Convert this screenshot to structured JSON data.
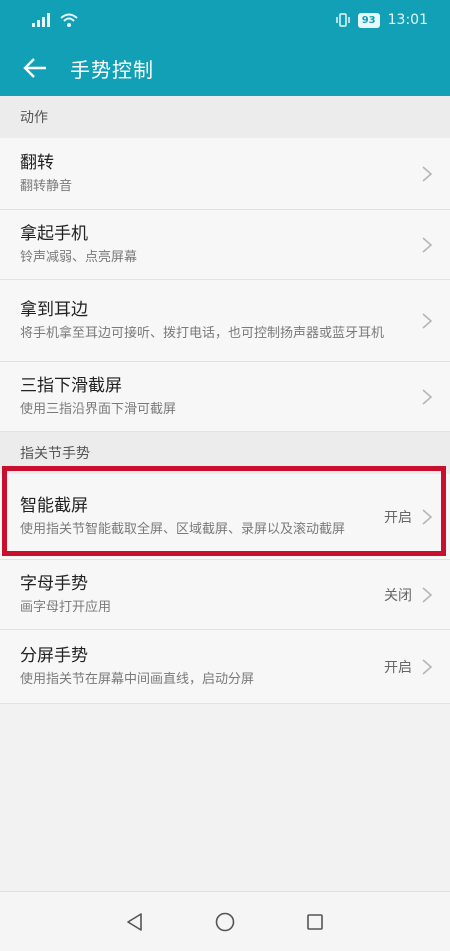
{
  "status_bar": {
    "battery": "93",
    "time": "13:01"
  },
  "header": {
    "title": "手势控制"
  },
  "sections": [
    {
      "title": "动作",
      "items": [
        {
          "title": "翻转",
          "subtitle": "翻转静音",
          "value": ""
        },
        {
          "title": "拿起手机",
          "subtitle": "铃声减弱、点亮屏幕",
          "value": ""
        },
        {
          "title": "拿到耳边",
          "subtitle": "将手机拿至耳边可接听、拨打电话，也可控制扬声器或蓝牙耳机",
          "value": ""
        },
        {
          "title": "三指下滑截屏",
          "subtitle": "使用三指沿界面下滑可截屏",
          "value": ""
        }
      ]
    },
    {
      "title": "指关节手势",
      "items": [
        {
          "title": "智能截屏",
          "subtitle": "使用指关节智能截取全屏、区域截屏、录屏以及滚动截屏",
          "value": "开启"
        },
        {
          "title": "字母手势",
          "subtitle": "画字母打开应用",
          "value": "关闭"
        },
        {
          "title": "分屏手势",
          "subtitle": "使用指关节在屏幕中间画直线，启动分屏",
          "value": "开启"
        }
      ]
    }
  ],
  "colors": {
    "primary": "#11a0b6",
    "highlight_border": "#c8102e"
  },
  "icons": {
    "back": "arrow-left-icon",
    "chevron": "chevron-right-icon",
    "nav_back": "triangle-back-icon",
    "nav_home": "circle-home-icon",
    "nav_recent": "square-recent-icon"
  }
}
